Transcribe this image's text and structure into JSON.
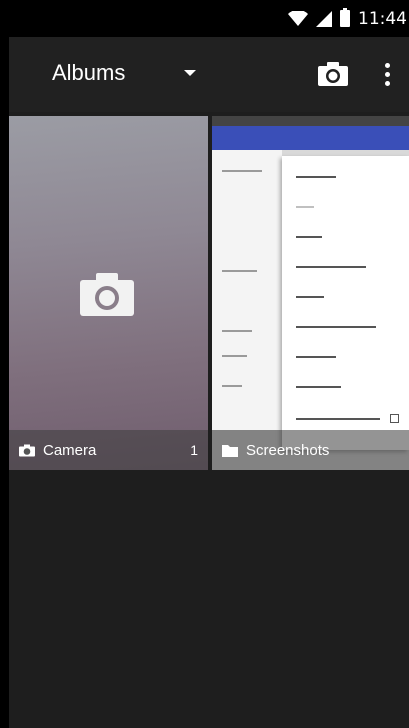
{
  "status_bar": {
    "time": "11:44"
  },
  "toolbar": {
    "title": "Albums"
  },
  "albums": [
    {
      "name": "Camera",
      "count": "1"
    },
    {
      "name": "Screenshots",
      "count": ""
    }
  ]
}
